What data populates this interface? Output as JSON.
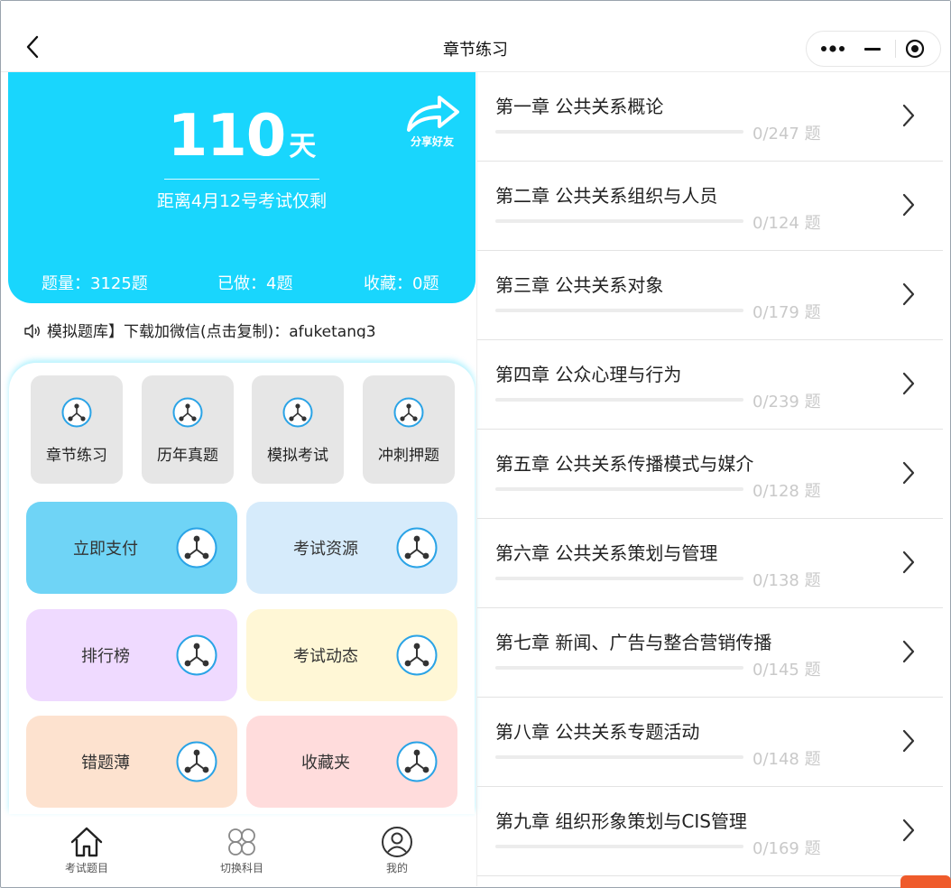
{
  "header": {
    "title": "章节练习"
  },
  "hero": {
    "days_number": "110",
    "days_unit": "天",
    "countdown": "距离4月12号考试仅剩",
    "share_label": "分享好友",
    "stats": {
      "total": "题量：3125题",
      "done": "已做：4题",
      "fav": "收藏：0题"
    }
  },
  "notice": {
    "text": "模拟题库】下载加微信(点击复制)：afuketang3"
  },
  "tiles": [
    {
      "label": "章节练习"
    },
    {
      "label": "历年真题"
    },
    {
      "label": "模拟考试"
    },
    {
      "label": "冲刺押题"
    }
  ],
  "cards": [
    {
      "label": "立即支付",
      "color": "#6fd4f6"
    },
    {
      "label": "考试资源",
      "color": "#d6ebfb"
    },
    {
      "label": "排行榜",
      "color": "#efdaff"
    },
    {
      "label": "考试动态",
      "color": "#fff7d6"
    },
    {
      "label": "错题薄",
      "color": "#fde2cf"
    },
    {
      "label": "收藏夹",
      "color": "#ffdcdc"
    }
  ],
  "tabbar": [
    {
      "label": "考试题目",
      "icon": "home-icon"
    },
    {
      "label": "切换科目",
      "icon": "grid-icon"
    },
    {
      "label": "我的",
      "icon": "user-icon"
    }
  ],
  "chapters": [
    {
      "name": "第一章 公共关系概论",
      "count": "0/247 题"
    },
    {
      "name": "第二章 公共关系组织与人员",
      "count": "0/124 题"
    },
    {
      "name": "第三章 公共关系对象",
      "count": "0/179 题"
    },
    {
      "name": "第四章 公众心理与行为",
      "count": "0/239 题"
    },
    {
      "name": "第五章 公共关系传播模式与媒介",
      "count": "0/128 题"
    },
    {
      "name": "第六章 公共关系策划与管理",
      "count": "0/138 题"
    },
    {
      "name": "第七章 新闻、广告与整合营销传播",
      "count": "0/145 题"
    },
    {
      "name": "第八章 公共关系专题活动",
      "count": "0/148 题"
    },
    {
      "name": "第九章 组织形象策划与CIS管理",
      "count": "0/169 题"
    }
  ],
  "colors": {
    "accent": "#19d6fd",
    "icon_ring": "#2aa3e6"
  }
}
